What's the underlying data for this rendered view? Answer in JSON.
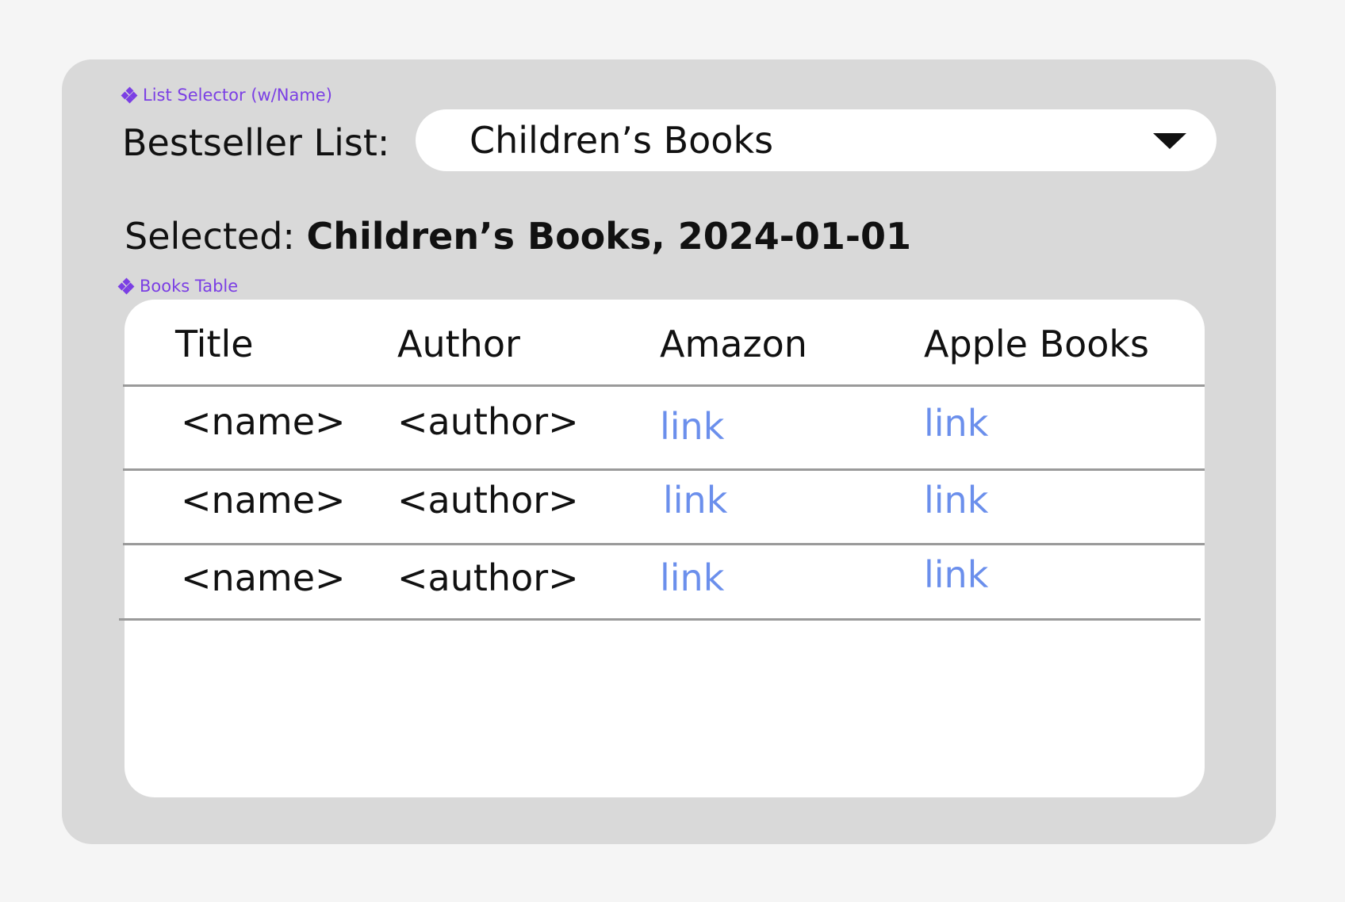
{
  "list_selector": {
    "tag": "List Selector (w/Name)",
    "label": "Bestseller List:",
    "selected_value": "Children’s Books"
  },
  "selection": {
    "prefix": "Selected:",
    "value": "Children’s Books, 2024-01-01"
  },
  "books_table": {
    "tag": "Books Table",
    "headers": [
      "Title",
      "Author",
      "Amazon",
      "Apple Books"
    ],
    "rows": [
      [
        "<name>",
        "<author>",
        "link",
        "link"
      ],
      [
        "<name>",
        "<author>",
        "link",
        "link"
      ],
      [
        "<name>",
        "<author>",
        "link",
        "link"
      ]
    ]
  },
  "colors": {
    "page_background": "#f5f5f5",
    "frame_background": "#d9d9d9",
    "component_tag": "#7b3fe4",
    "link": "#6b8fec"
  },
  "icons": {
    "component_tag_icon": "component-diamond-icon",
    "dropdown_icon": "caret-down-icon"
  }
}
